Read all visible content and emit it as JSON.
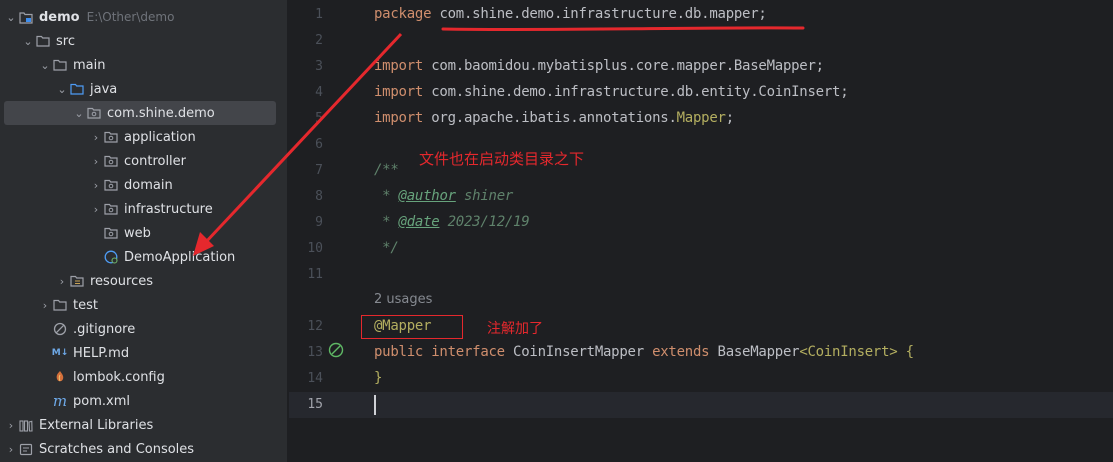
{
  "project_tree": {
    "items": [
      {
        "label": "demo",
        "path": "E:\\Other\\demo",
        "icon": "module-folder-icon",
        "chev": "⌄",
        "indent": 0,
        "bold": true
      },
      {
        "label": "src",
        "icon": "folder-icon",
        "chev": "⌄",
        "indent": 1
      },
      {
        "label": "main",
        "icon": "folder-icon",
        "chev": "⌄",
        "indent": 2
      },
      {
        "label": "java",
        "icon": "source-folder-icon",
        "chev": "⌄",
        "indent": 3
      },
      {
        "label": "com.shine.demo",
        "icon": "package-icon",
        "chev": "⌄",
        "indent": 4,
        "selected": true
      },
      {
        "label": "application",
        "icon": "package-icon",
        "chev": "›",
        "indent": 5
      },
      {
        "label": "controller",
        "icon": "package-icon",
        "chev": "›",
        "indent": 5
      },
      {
        "label": "domain",
        "icon": "package-icon",
        "chev": "›",
        "indent": 5
      },
      {
        "label": "infrastructure",
        "icon": "package-icon",
        "chev": "›",
        "indent": 5
      },
      {
        "label": "web",
        "icon": "package-icon",
        "chev": "",
        "indent": 5
      },
      {
        "label": "DemoApplication",
        "icon": "spring-boot-class-icon",
        "chev": "",
        "indent": 5
      },
      {
        "label": "resources",
        "icon": "resources-folder-icon",
        "chev": "›",
        "indent": 3
      },
      {
        "label": "test",
        "icon": "folder-icon",
        "chev": "›",
        "indent": 2
      },
      {
        "label": ".gitignore",
        "icon": "gitignore-icon",
        "chev": "",
        "indent": 2
      },
      {
        "label": "HELP.md",
        "icon": "markdown-icon",
        "chev": "",
        "indent": 2
      },
      {
        "label": "lombok.config",
        "icon": "config-icon",
        "chev": "",
        "indent": 2
      },
      {
        "label": "pom.xml",
        "icon": "maven-icon",
        "chev": "",
        "indent": 2
      },
      {
        "label": "External Libraries",
        "icon": "libraries-icon",
        "chev": "›",
        "indent": 0
      },
      {
        "label": "Scratches and Consoles",
        "icon": "scratches-icon",
        "chev": "›",
        "indent": 0
      }
    ]
  },
  "editor": {
    "line_numbers": [
      "1",
      "2",
      "3",
      "4",
      "5",
      "6",
      "7",
      "8",
      "9",
      "10",
      "11",
      "12",
      "13",
      "14",
      "15"
    ],
    "lines": {
      "l1_kw": "package",
      "l1_rest": " com.shine.demo.infrastructure.db.mapper;",
      "l3_kw": "import",
      "l3_rest": " com.baomidou.mybatisplus.core.mapper.BaseMapper;",
      "l4_kw": "import",
      "l4_rest": " com.shine.demo.infrastructure.db.entity.CoinInsert;",
      "l5_kw": "import",
      "l5_rest": " org.apache.ibatis.annotations.",
      "l5_ann": "Mapper",
      "l5_end": ";",
      "l7": "/**",
      "l8_star": " * ",
      "l8_tag": "@author",
      "l8_val": " shiner",
      "l9_star": " * ",
      "l9_tag": "@date",
      "l9_val": " 2023/12/19",
      "l10": " */",
      "usages": "2 usages",
      "l12": "@Mapper",
      "l13_kw1": "public interface",
      "l13_name": " CoinInsertMapper ",
      "l13_kw2": "extends",
      "l13_type": " BaseMapper",
      "l13_generic": "<CoinInsert>",
      "l13_brace": " {",
      "l14": "}"
    }
  },
  "annotations": {
    "note_dir": "文件也在启动类目录之下",
    "note_mapper": "注解加了"
  },
  "colors": {
    "accent_red": "#e5282d",
    "keyword": "#cf8e6d",
    "annotation": "#b3ae60"
  }
}
